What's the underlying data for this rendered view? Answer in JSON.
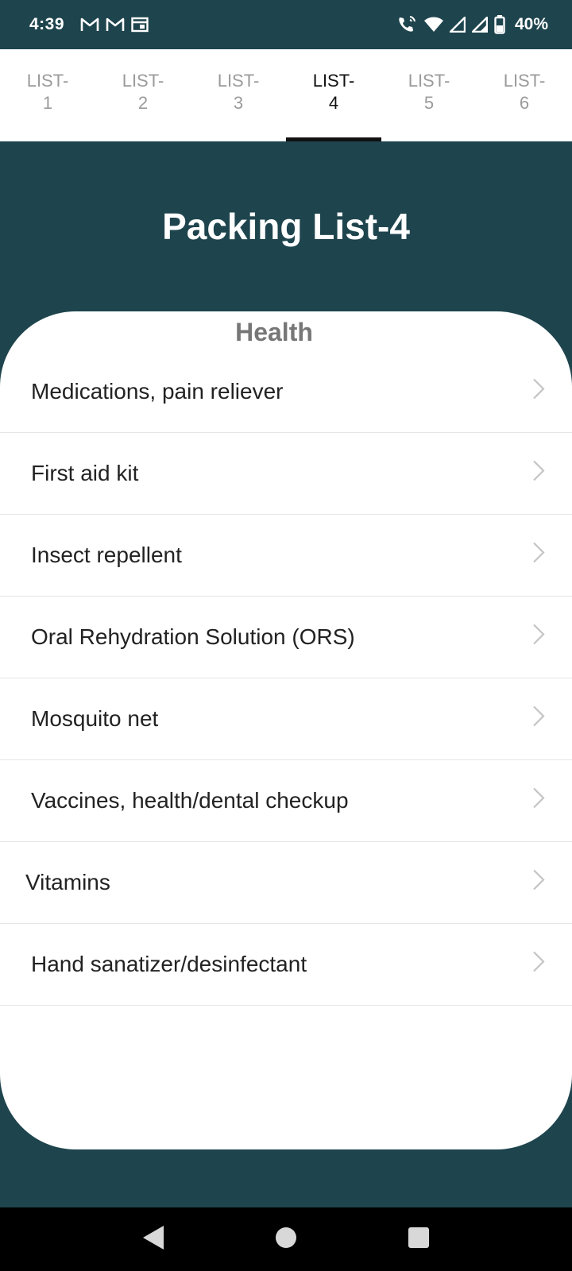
{
  "status_bar": {
    "time": "4:39",
    "battery": "40%",
    "left_icons": [
      "gmail-icon",
      "gmail-icon",
      "calendar-icon"
    ],
    "right_icons": [
      "wifi-calling-icon",
      "wifi-icon",
      "signal-icon",
      "signal-icon",
      "battery-icon"
    ]
  },
  "tabs": [
    {
      "label_line1": "LIST-",
      "label_line2": "1",
      "active": false
    },
    {
      "label_line1": "LIST-",
      "label_line2": "2",
      "active": false
    },
    {
      "label_line1": "LIST-",
      "label_line2": "3",
      "active": false
    },
    {
      "label_line1": "LIST-",
      "label_line2": "4",
      "active": true
    },
    {
      "label_line1": "LIST-",
      "label_line2": "5",
      "active": false
    },
    {
      "label_line1": "LIST-",
      "label_line2": "6",
      "active": false
    }
  ],
  "page_title": "Packing List-4",
  "section": {
    "title": "Health",
    "items": [
      {
        "label": "Medications, pain reliever"
      },
      {
        "label": "First aid kit"
      },
      {
        "label": "Insect repellent"
      },
      {
        "label": "Oral Rehydration Solution (ORS)"
      },
      {
        "label": "Mosquito net"
      },
      {
        "label": "Vaccines, health/dental checkup"
      },
      {
        "label": "Vitamins"
      },
      {
        "label": "Hand sanatizer/desinfectant"
      }
    ]
  },
  "colors": {
    "header_bg": "#1e444d",
    "card_bg": "#ffffff",
    "active_tab": "#111111",
    "inactive_tab": "#9b9b9b"
  }
}
